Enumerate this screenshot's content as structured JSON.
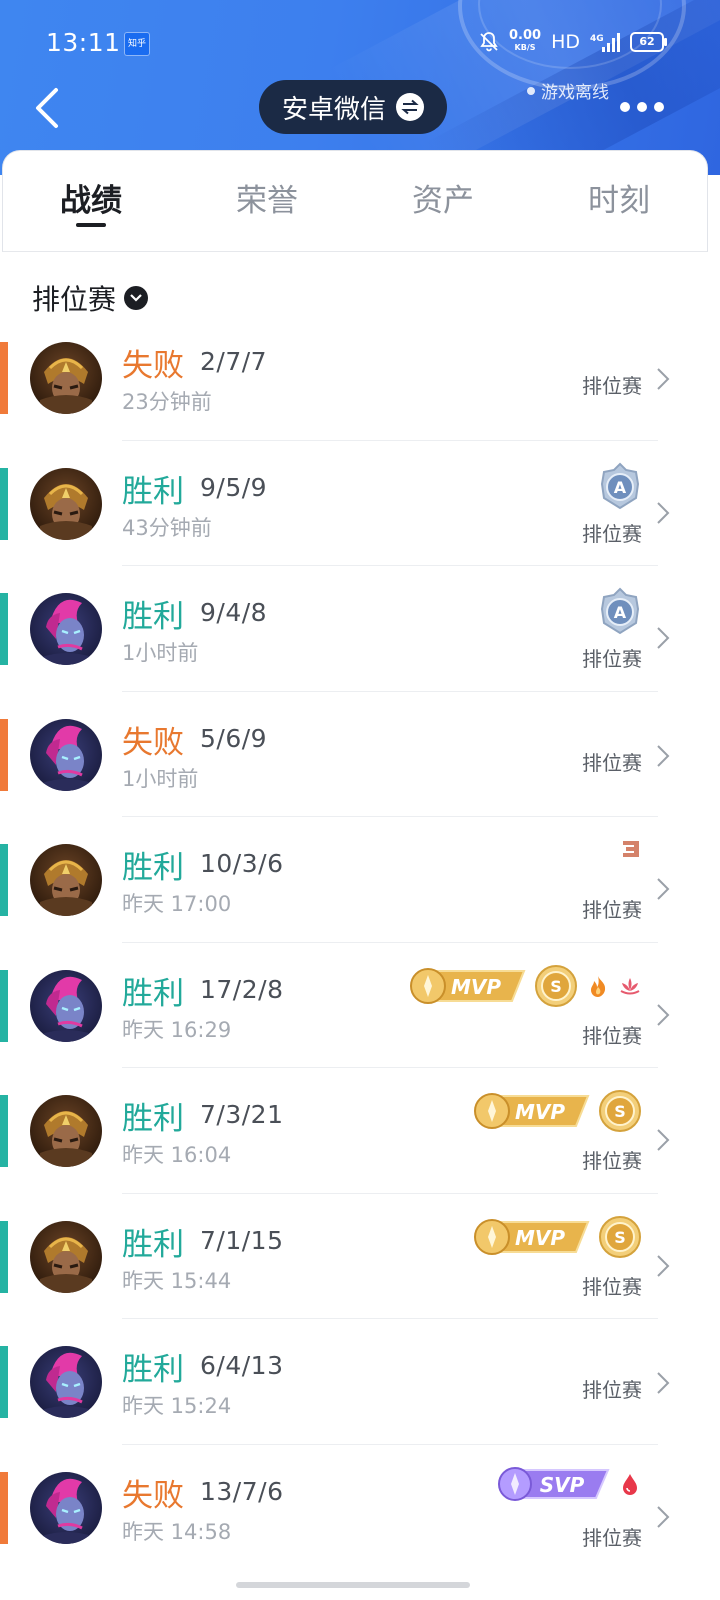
{
  "status_bar": {
    "time": "13:11",
    "app_icon_text": "知乎",
    "net_speed": "0.00",
    "net_unit": "KB/S",
    "hd": "HD",
    "network": "4G",
    "battery": "62"
  },
  "header": {
    "account_name": "安卓微信",
    "game_status": "游戏离线"
  },
  "tabs": [
    {
      "label": "战绩",
      "active": true
    },
    {
      "label": "荣誉",
      "active": false
    },
    {
      "label": "资产",
      "active": false
    },
    {
      "label": "时刻",
      "active": false
    }
  ],
  "filter": {
    "label": "排位赛"
  },
  "matches": [
    {
      "result": "失败",
      "kda": "2/7/7",
      "time": "23分钟前",
      "mode": "排位赛",
      "hero": "warrior",
      "badges": []
    },
    {
      "result": "胜利",
      "kda": "9/5/9",
      "time": "43分钟前",
      "mode": "排位赛",
      "hero": "warrior",
      "badges": [
        "a-rank"
      ]
    },
    {
      "result": "胜利",
      "kda": "9/4/8",
      "time": "1小时前",
      "mode": "排位赛",
      "hero": "assassin",
      "badges": [
        "a-rank"
      ]
    },
    {
      "result": "失败",
      "kda": "5/6/9",
      "time": "1小时前",
      "mode": "排位赛",
      "hero": "assassin",
      "badges": []
    },
    {
      "result": "胜利",
      "kda": "10/3/6",
      "time": "昨天 17:00",
      "mode": "排位赛",
      "hero": "warrior",
      "badges": [
        "triple-kill"
      ]
    },
    {
      "result": "胜利",
      "kda": "17/2/8",
      "time": "昨天 16:29",
      "mode": "排位赛",
      "hero": "assassin",
      "badges": [
        "mvp",
        "s-rank",
        "fire",
        "lotus"
      ]
    },
    {
      "result": "胜利",
      "kda": "7/3/21",
      "time": "昨天 16:04",
      "mode": "排位赛",
      "hero": "warrior",
      "badges": [
        "mvp",
        "s-rank"
      ]
    },
    {
      "result": "胜利",
      "kda": "7/1/15",
      "time": "昨天 15:44",
      "mode": "排位赛",
      "hero": "warrior",
      "badges": [
        "mvp",
        "s-rank"
      ]
    },
    {
      "result": "胜利",
      "kda": "6/4/13",
      "time": "昨天 15:24",
      "mode": "排位赛",
      "hero": "assassin",
      "badges": []
    },
    {
      "result": "失败",
      "kda": "13/7/6",
      "time": "昨天 14:58",
      "mode": "排位赛",
      "hero": "assassin",
      "badges": [
        "svp",
        "blood-drop"
      ]
    }
  ],
  "badge_text": {
    "mvp": "MVP",
    "svp": "SVP",
    "s": "S",
    "a": "A"
  },
  "colors": {
    "win": "#22a99a",
    "loss": "#e8782f",
    "header_blue": "#3d7fee",
    "gold": "#e0a63c",
    "purple": "#8c6cf0"
  }
}
